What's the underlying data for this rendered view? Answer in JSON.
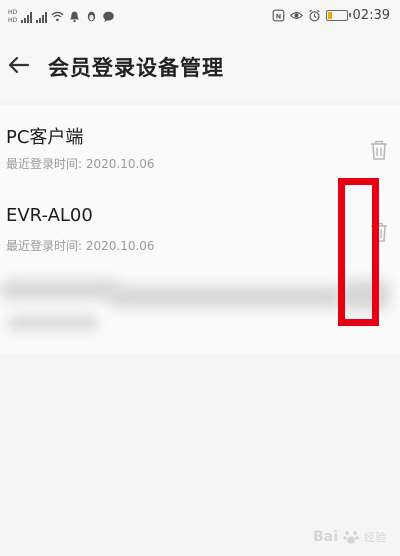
{
  "status_bar": {
    "sim1_label": "HD",
    "sim2_label": "HD",
    "time": "02:39",
    "battery_level": 0.25,
    "icons": [
      "signal-icon",
      "wifi-icon",
      "bell-icon",
      "penguin-icon",
      "chat-icon",
      "nfc-icon",
      "eye-icon",
      "alarm-icon",
      "battery-icon"
    ]
  },
  "header": {
    "title": "会员登录设备管理",
    "back_icon": "arrow-left-icon"
  },
  "devices": [
    {
      "name": "PC客户端",
      "last_login": "最近登录时间: 2020.10.06",
      "delete_icon": "trash-icon"
    },
    {
      "name": "EVR-AL00",
      "last_login": "最近登录时间: 2020.10.06",
      "delete_icon": "trash-icon"
    }
  ],
  "watermark": {
    "text": "Bai",
    "sub": "经验"
  },
  "colors": {
    "highlight": "#e60012",
    "background": "#f5f5f5",
    "battery": "#f2a900"
  }
}
